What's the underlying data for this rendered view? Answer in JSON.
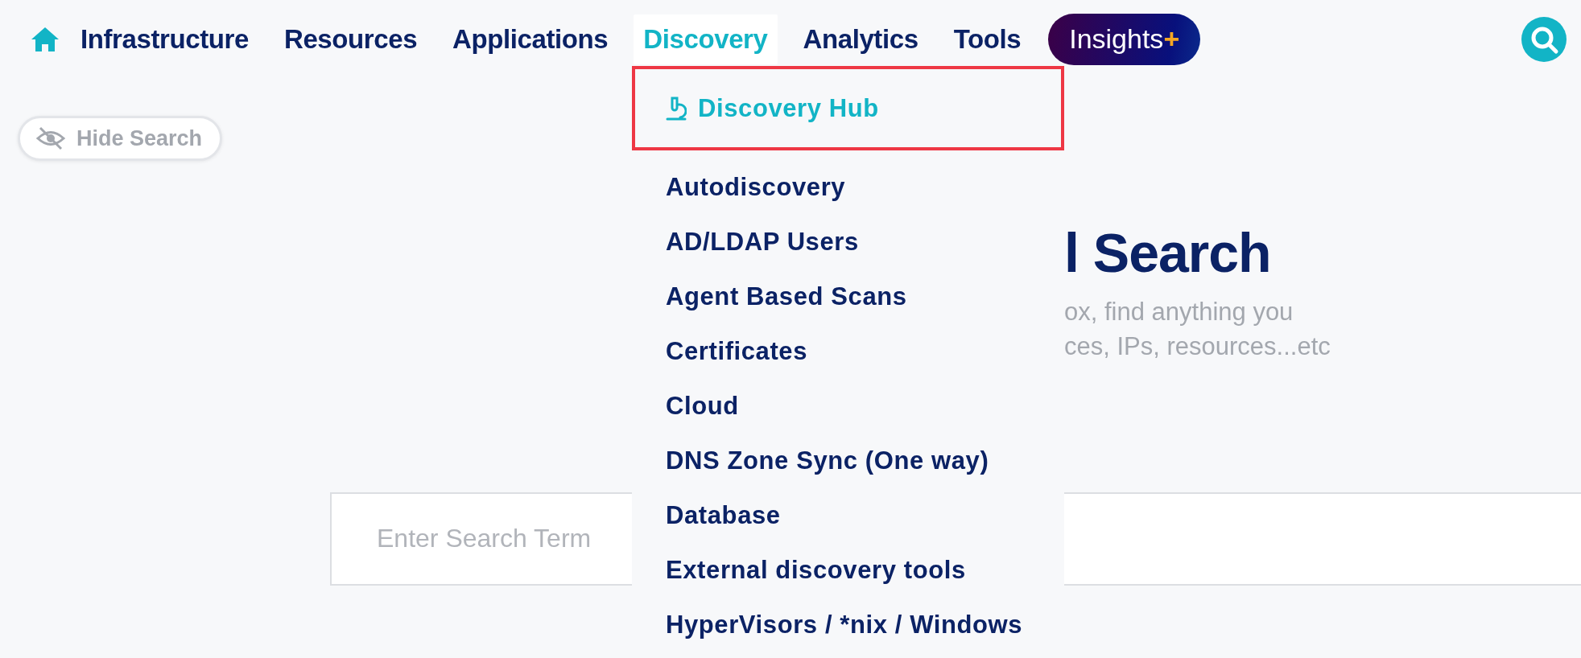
{
  "nav": {
    "tabs": [
      {
        "label": "Infrastructure",
        "selected": false
      },
      {
        "label": "Resources",
        "selected": false
      },
      {
        "label": "Applications",
        "selected": false
      },
      {
        "label": "Discovery",
        "selected": true
      },
      {
        "label": "Analytics",
        "selected": false
      },
      {
        "label": "Tools",
        "selected": false
      }
    ],
    "insights": {
      "label": "Insights",
      "accent": "+"
    }
  },
  "hide_search_button": {
    "label": "Hide Search"
  },
  "discovery_menu": {
    "items": [
      {
        "kind": "hub",
        "label": "Discovery Hub",
        "outlined": true
      },
      {
        "kind": "heading",
        "label": "Autodiscovery",
        "outlined": false
      },
      {
        "kind": "link",
        "label": "AD/LDAP Users",
        "outlined": false
      },
      {
        "kind": "link",
        "label": "Agent Based Scans",
        "outlined": false
      },
      {
        "kind": "link",
        "label": "Certificates",
        "outlined": false
      },
      {
        "kind": "link",
        "label": "Cloud",
        "outlined": false
      },
      {
        "kind": "link",
        "label": "DNS Zone Sync (One way)",
        "outlined": false
      },
      {
        "kind": "link",
        "label": "Database",
        "outlined": false
      },
      {
        "kind": "link",
        "label": "External discovery tools",
        "outlined": false
      },
      {
        "kind": "link",
        "label": "HyperVisors / *nix / Windows",
        "outlined": false
      }
    ]
  },
  "hero": {
    "title": "l Search",
    "subtitle_lines": [
      "ox, find anything you",
      "ces, IPs, resources...etc"
    ]
  },
  "search": {
    "placeholder": "Enter Search Term"
  }
}
